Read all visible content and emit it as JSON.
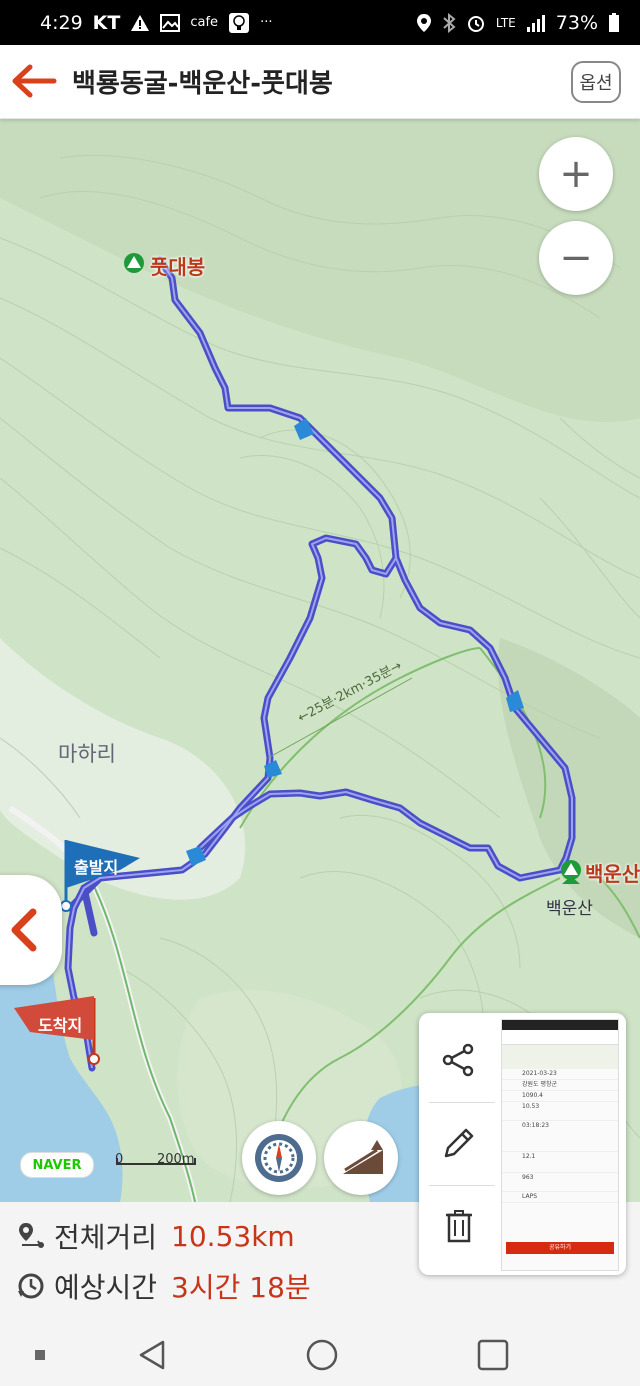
{
  "status_bar": {
    "time": "4:29",
    "carrier": "KT",
    "app_label": "cafe",
    "more": "···",
    "network": "LTE",
    "battery": "73%"
  },
  "header": {
    "title": "백룡동굴-백운산-풋대봉",
    "options_label": "옵션"
  },
  "map": {
    "zoom_in": "+",
    "zoom_out": "−",
    "peak_top_label": "풋대봉",
    "peak_right_label": "백운산",
    "peak_right_sub": "백운산",
    "village_label": "마하리",
    "route_distance_label": "←25분·2km·35분→",
    "start_flag": "출발지",
    "end_flag": "도착지",
    "naver_logo": "NAVER",
    "scale_zero": "0",
    "scale_value": "200m",
    "route_color": "#4a4fc7",
    "accent_color": "#c8361a"
  },
  "action_panel": {
    "share_icon": "share-icon",
    "edit_icon": "pencil-icon",
    "delete_icon": "trash-icon",
    "preview": {
      "rows": [
        "2021-03-23",
        "강원도 평창군",
        "1090.4",
        "10.53",
        "03:18:23",
        "12.1",
        "963",
        "LAPS"
      ],
      "button": "공유하기"
    }
  },
  "summary": {
    "distance_label": "전체거리",
    "distance_value": "10.53km",
    "time_label": "예상시간",
    "time_value": "3시간 18분"
  }
}
